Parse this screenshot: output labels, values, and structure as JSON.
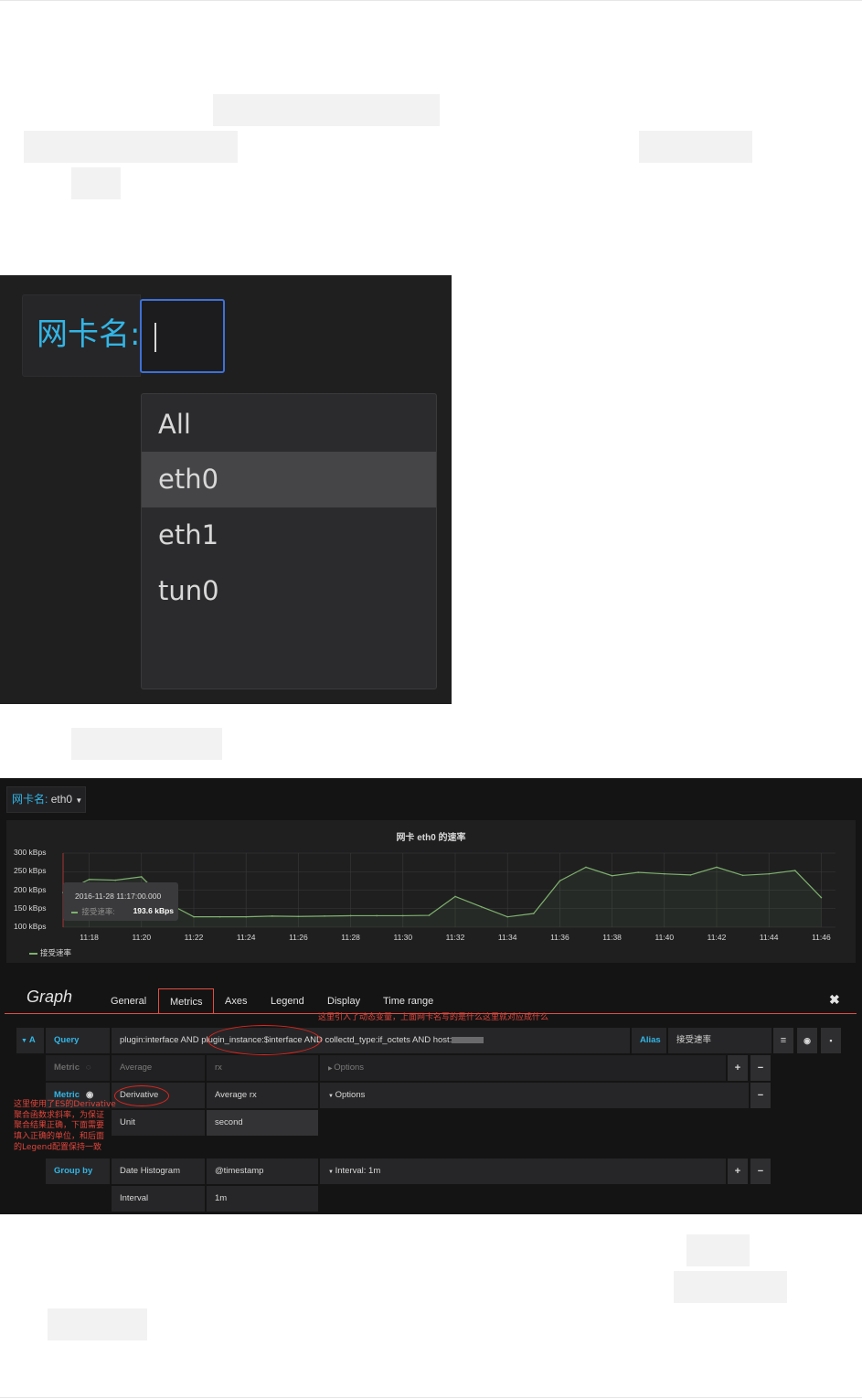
{
  "variable_picker": {
    "label": "网卡名:",
    "options": [
      "All",
      "eth0",
      "eth1",
      "tun0"
    ],
    "highlighted": "eth0"
  },
  "dashboard": {
    "variable_label": "网卡名:",
    "variable_value": "eth0",
    "panel": {
      "title": "网卡 eth0 的速率",
      "tooltip_time": "2016-11-28 11:17:00.000",
      "tooltip_series": "接受速率:",
      "tooltip_value": "193.6 kBps",
      "legend_label": "接受速率"
    }
  },
  "chart_data": {
    "type": "line",
    "title": "网卡 eth0 的速率",
    "xlabel": "",
    "ylabel": "",
    "y_ticks": [
      "300 kBps",
      "250 kBps",
      "200 kBps",
      "150 kBps",
      "100 kBps"
    ],
    "x_ticks": [
      "11:18",
      "11:20",
      "11:22",
      "11:24",
      "11:26",
      "11:28",
      "11:30",
      "11:32",
      "11:34",
      "11:36",
      "11:38",
      "11:40",
      "11:42",
      "11:44",
      "11:46"
    ],
    "ylim": [
      100,
      300
    ],
    "series_color": "#7eb26d",
    "legend_position": "bottom-left",
    "series": [
      {
        "name": "接受速率",
        "x": [
          "11:17",
          "11:18",
          "11:19",
          "11:20",
          "11:21",
          "11:22",
          "11:23",
          "11:24",
          "11:25",
          "11:26",
          "11:27",
          "11:28",
          "11:29",
          "11:30",
          "11:31",
          "11:32",
          "11:33",
          "11:34",
          "11:35",
          "11:36",
          "11:37",
          "11:38",
          "11:39",
          "11:40",
          "11:41",
          "11:42",
          "11:43",
          "11:44",
          "11:45",
          "11:46"
        ],
        "values": [
          193.6,
          229,
          227,
          236,
          165,
          128,
          128,
          128,
          130,
          129,
          130,
          131,
          131,
          131,
          132,
          183,
          155,
          128,
          137,
          225,
          262,
          239,
          248,
          244,
          241,
          262,
          240,
          244,
          253,
          180
        ]
      }
    ]
  },
  "editor": {
    "title": "Graph",
    "tabs": [
      "General",
      "Metrics",
      "Axes",
      "Legend",
      "Display",
      "Time range"
    ],
    "active_tab": "Metrics",
    "query_ref": "A",
    "query_label": "Query",
    "query_text_1": "plugin:interface AND ",
    "query_text_2": "plugin_instance:$interface",
    "query_text_3": " AND collectd_type:if_octets AND host:",
    "alias_label": "Alias",
    "alias_value": "接受速率",
    "metric_label": "Metric",
    "metric1_type": "Average",
    "metric1_field": "rx",
    "metric1_options": "Options",
    "metric2_type": "Derivative",
    "metric2_field": "Average rx",
    "metric2_options": "Options",
    "unit_label": "Unit",
    "unit_value": "second",
    "group_by_label": "Group by",
    "group_by_type": "Date Histogram",
    "group_by_field": "@timestamp",
    "group_by_options": "Interval: 1m",
    "interval_label": "Interval",
    "interval_value": "1m"
  },
  "annotations": {
    "note_query": "这里引入了动态变量，上面网卡名写的是什么这里就对应成什么",
    "note_metric_1": "这里使用了ES的Derivative",
    "note_metric_2": "聚合函数求斜率，为保证",
    "note_metric_3": "聚合结果正确，下面需要",
    "note_metric_4": "填入正确的单位，和后面",
    "note_metric_5": "的Legend配置保持一致"
  }
}
